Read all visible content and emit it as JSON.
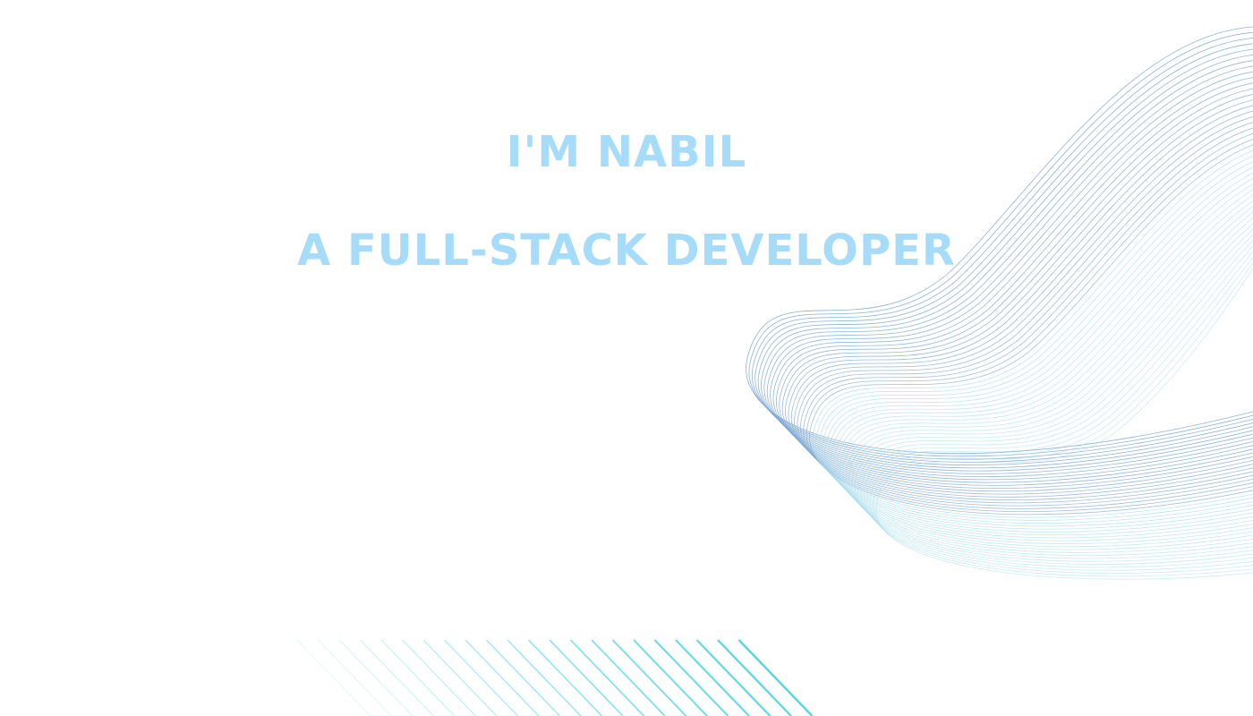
{
  "hero": {
    "line1": "I'M NABIL",
    "line2": "A FULL-STACK DEVELOPER"
  },
  "colors": {
    "text": "#a6dcf9",
    "wave_light": "#a5dceb",
    "wave_dark": "#7fa8d2",
    "stripes": "#54d6e0",
    "background": "#ffffff"
  },
  "decorations": {
    "wave": "wireframe-wave-graphic",
    "stripes": "diagonal-stripes-graphic"
  }
}
